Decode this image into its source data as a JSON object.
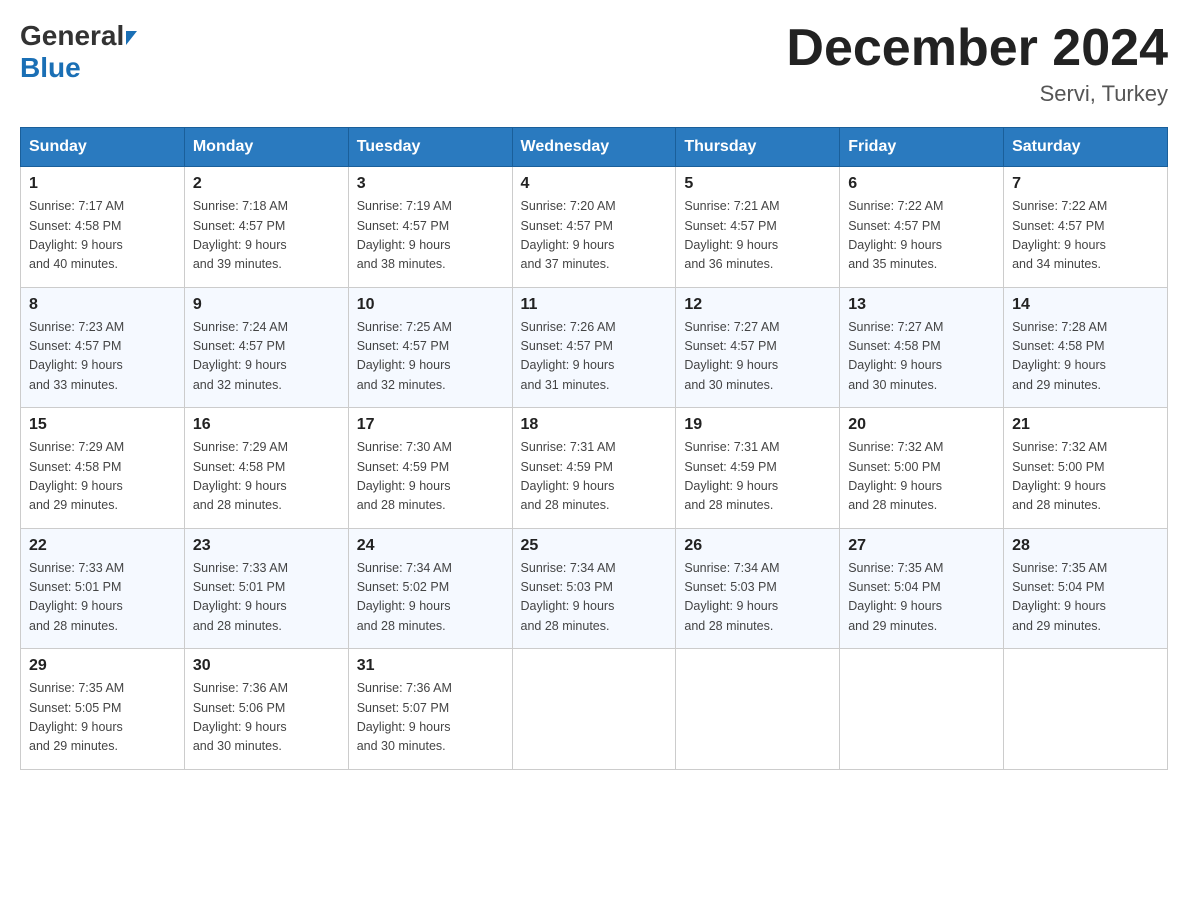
{
  "header": {
    "title": "December 2024",
    "subtitle": "Servi, Turkey",
    "logo_general": "General",
    "logo_blue": "Blue"
  },
  "days_of_week": [
    "Sunday",
    "Monday",
    "Tuesday",
    "Wednesday",
    "Thursday",
    "Friday",
    "Saturday"
  ],
  "weeks": [
    [
      {
        "day": "1",
        "sunrise": "7:17 AM",
        "sunset": "4:58 PM",
        "daylight": "9 hours and 40 minutes."
      },
      {
        "day": "2",
        "sunrise": "7:18 AM",
        "sunset": "4:57 PM",
        "daylight": "9 hours and 39 minutes."
      },
      {
        "day": "3",
        "sunrise": "7:19 AM",
        "sunset": "4:57 PM",
        "daylight": "9 hours and 38 minutes."
      },
      {
        "day": "4",
        "sunrise": "7:20 AM",
        "sunset": "4:57 PM",
        "daylight": "9 hours and 37 minutes."
      },
      {
        "day": "5",
        "sunrise": "7:21 AM",
        "sunset": "4:57 PM",
        "daylight": "9 hours and 36 minutes."
      },
      {
        "day": "6",
        "sunrise": "7:22 AM",
        "sunset": "4:57 PM",
        "daylight": "9 hours and 35 minutes."
      },
      {
        "day": "7",
        "sunrise": "7:22 AM",
        "sunset": "4:57 PM",
        "daylight": "9 hours and 34 minutes."
      }
    ],
    [
      {
        "day": "8",
        "sunrise": "7:23 AM",
        "sunset": "4:57 PM",
        "daylight": "9 hours and 33 minutes."
      },
      {
        "day": "9",
        "sunrise": "7:24 AM",
        "sunset": "4:57 PM",
        "daylight": "9 hours and 32 minutes."
      },
      {
        "day": "10",
        "sunrise": "7:25 AM",
        "sunset": "4:57 PM",
        "daylight": "9 hours and 32 minutes."
      },
      {
        "day": "11",
        "sunrise": "7:26 AM",
        "sunset": "4:57 PM",
        "daylight": "9 hours and 31 minutes."
      },
      {
        "day": "12",
        "sunrise": "7:27 AM",
        "sunset": "4:57 PM",
        "daylight": "9 hours and 30 minutes."
      },
      {
        "day": "13",
        "sunrise": "7:27 AM",
        "sunset": "4:58 PM",
        "daylight": "9 hours and 30 minutes."
      },
      {
        "day": "14",
        "sunrise": "7:28 AM",
        "sunset": "4:58 PM",
        "daylight": "9 hours and 29 minutes."
      }
    ],
    [
      {
        "day": "15",
        "sunrise": "7:29 AM",
        "sunset": "4:58 PM",
        "daylight": "9 hours and 29 minutes."
      },
      {
        "day": "16",
        "sunrise": "7:29 AM",
        "sunset": "4:58 PM",
        "daylight": "9 hours and 28 minutes."
      },
      {
        "day": "17",
        "sunrise": "7:30 AM",
        "sunset": "4:59 PM",
        "daylight": "9 hours and 28 minutes."
      },
      {
        "day": "18",
        "sunrise": "7:31 AM",
        "sunset": "4:59 PM",
        "daylight": "9 hours and 28 minutes."
      },
      {
        "day": "19",
        "sunrise": "7:31 AM",
        "sunset": "4:59 PM",
        "daylight": "9 hours and 28 minutes."
      },
      {
        "day": "20",
        "sunrise": "7:32 AM",
        "sunset": "5:00 PM",
        "daylight": "9 hours and 28 minutes."
      },
      {
        "day": "21",
        "sunrise": "7:32 AM",
        "sunset": "5:00 PM",
        "daylight": "9 hours and 28 minutes."
      }
    ],
    [
      {
        "day": "22",
        "sunrise": "7:33 AM",
        "sunset": "5:01 PM",
        "daylight": "9 hours and 28 minutes."
      },
      {
        "day": "23",
        "sunrise": "7:33 AM",
        "sunset": "5:01 PM",
        "daylight": "9 hours and 28 minutes."
      },
      {
        "day": "24",
        "sunrise": "7:34 AM",
        "sunset": "5:02 PM",
        "daylight": "9 hours and 28 minutes."
      },
      {
        "day": "25",
        "sunrise": "7:34 AM",
        "sunset": "5:03 PM",
        "daylight": "9 hours and 28 minutes."
      },
      {
        "day": "26",
        "sunrise": "7:34 AM",
        "sunset": "5:03 PM",
        "daylight": "9 hours and 28 minutes."
      },
      {
        "day": "27",
        "sunrise": "7:35 AM",
        "sunset": "5:04 PM",
        "daylight": "9 hours and 29 minutes."
      },
      {
        "day": "28",
        "sunrise": "7:35 AM",
        "sunset": "5:04 PM",
        "daylight": "9 hours and 29 minutes."
      }
    ],
    [
      {
        "day": "29",
        "sunrise": "7:35 AM",
        "sunset": "5:05 PM",
        "daylight": "9 hours and 29 minutes."
      },
      {
        "day": "30",
        "sunrise": "7:36 AM",
        "sunset": "5:06 PM",
        "daylight": "9 hours and 30 minutes."
      },
      {
        "day": "31",
        "sunrise": "7:36 AM",
        "sunset": "5:07 PM",
        "daylight": "9 hours and 30 minutes."
      },
      null,
      null,
      null,
      null
    ]
  ],
  "labels": {
    "sunrise": "Sunrise:",
    "sunset": "Sunset:",
    "daylight": "Daylight:"
  }
}
